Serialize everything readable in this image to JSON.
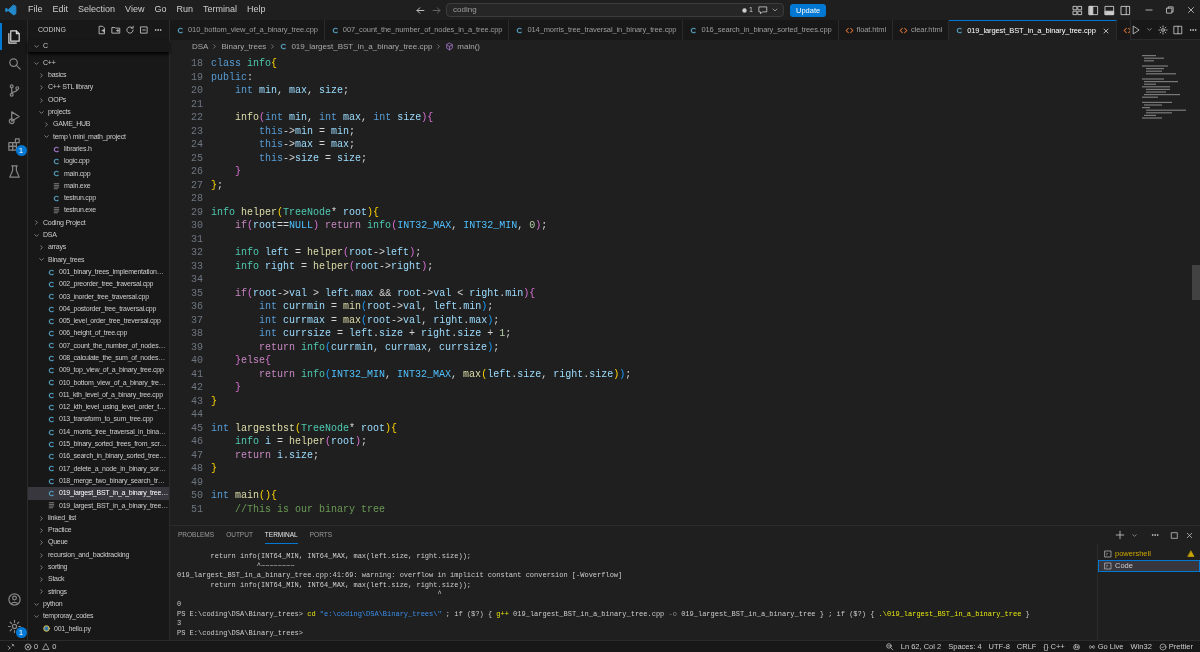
{
  "title_bar": {
    "menu": [
      "File",
      "Edit",
      "Selection",
      "View",
      "Go",
      "Run",
      "Terminal",
      "Help"
    ],
    "command_center": "coding",
    "notification_count": "1",
    "update_button": "Update"
  },
  "activity_bar": [
    {
      "kind": "explorer",
      "selected": true
    },
    {
      "kind": "search",
      "selected": false
    },
    {
      "kind": "source_control",
      "selected": false
    },
    {
      "kind": "run_debug",
      "selected": false
    },
    {
      "kind": "extensions",
      "selected": false,
      "badge": "1"
    },
    {
      "kind": "testing",
      "selected": false
    },
    {
      "kind": "account",
      "selected": false
    },
    {
      "kind": "manage",
      "selected": false,
      "badge": "1"
    }
  ],
  "sidebar": {
    "title": "CODING",
    "tree": [
      {
        "label": "C",
        "kind": "folder",
        "expanded": true,
        "selected": false
      },
      {
        "label": "C++",
        "kind": "folder",
        "expanded": true,
        "selected": false,
        "children": [
          {
            "label": "basics",
            "kind": "folder",
            "expanded": false,
            "selected": false
          },
          {
            "label": "C++ STL library",
            "kind": "folder",
            "expanded": false,
            "selected": false
          },
          {
            "label": "OOPs",
            "kind": "folder",
            "expanded": false,
            "selected": false
          },
          {
            "label": "projects",
            "kind": "folder",
            "expanded": true,
            "selected": false,
            "children": [
              {
                "label": "GAME_HUB",
                "kind": "folder",
                "expanded": false,
                "selected": false
              },
              {
                "label": "temp \\ mini_math_project",
                "kind": "folder",
                "expanded": true,
                "selected": false,
                "children": [
                  {
                    "label": "libraries.h",
                    "kind": "h",
                    "selected": false
                  },
                  {
                    "label": "logic.cpp",
                    "kind": "cpp",
                    "selected": false
                  },
                  {
                    "label": "main.cpp",
                    "kind": "cpp",
                    "selected": false
                  },
                  {
                    "label": "main.exe",
                    "kind": "exe",
                    "selected": false
                  },
                  {
                    "label": "testrun.cpp",
                    "kind": "cpp",
                    "selected": false
                  },
                  {
                    "label": "testrun.exe",
                    "kind": "exe",
                    "selected": false
                  }
                ]
              }
            ]
          }
        ]
      },
      {
        "label": "Coding Project",
        "kind": "folder",
        "expanded": false,
        "selected": false
      },
      {
        "label": "DSA",
        "kind": "folder",
        "expanded": true,
        "selected": false,
        "children": [
          {
            "label": "arrays",
            "kind": "folder",
            "expanded": false,
            "selected": false
          },
          {
            "label": "Binary_trees",
            "kind": "folder",
            "expanded": true,
            "selected": false,
            "children": [
              {
                "label": "001_binary_trees_implementation…",
                "kind": "cpp",
                "selected": false
              },
              {
                "label": "002_preorder_tree_traversal.cpp",
                "kind": "cpp",
                "selected": false
              },
              {
                "label": "003_inorder_tree_traversal.cpp",
                "kind": "cpp",
                "selected": false
              },
              {
                "label": "004_postorder_tree_traversal.cpp",
                "kind": "cpp",
                "selected": false
              },
              {
                "label": "005_level_order_tree_treversal.cpp",
                "kind": "cpp",
                "selected": false
              },
              {
                "label": "006_height_of_tree.cpp",
                "kind": "cpp",
                "selected": false
              },
              {
                "label": "007_count_the_number_of_nodes…",
                "kind": "cpp",
                "selected": false
              },
              {
                "label": "008_calculate_the_sum_of_nodes…",
                "kind": "cpp",
                "selected": false
              },
              {
                "label": "009_top_view_of_a_binary_tree.cpp",
                "kind": "cpp",
                "selected": false
              },
              {
                "label": "010_bottom_view_of_a_binary_tre…",
                "kind": "cpp",
                "selected": false
              },
              {
                "label": "011_kth_level_of_a_binary_tree.cpp",
                "kind": "cpp",
                "selected": false
              },
              {
                "label": "012_kth_level_using_level_order_t…",
                "kind": "cpp",
                "selected": false
              },
              {
                "label": "013_transform_to_sum_tree.cpp",
                "kind": "cpp",
                "selected": false
              },
              {
                "label": "014_morris_tree_traversal_in_bina…",
                "kind": "cpp",
                "selected": false
              },
              {
                "label": "015_binary_sorted_trees_from_scr…",
                "kind": "cpp",
                "selected": false
              },
              {
                "label": "016_search_in_binary_sorted_tree…",
                "kind": "cpp",
                "selected": false
              },
              {
                "label": "017_delete_a_node_in_binary_sor…",
                "kind": "cpp",
                "selected": false
              },
              {
                "label": "018_merge_two_binary_search_tr…",
                "kind": "cpp",
                "selected": false
              },
              {
                "label": "019_largest_BST_in_a_binary_tree…",
                "kind": "cpp",
                "selected": true
              },
              {
                "label": "019_largest_BST_in_a_binary_tree…",
                "kind": "exe",
                "selected": false
              }
            ]
          },
          {
            "label": "linked_list",
            "kind": "folder",
            "expanded": false,
            "selected": false
          },
          {
            "label": "Practice",
            "kind": "folder",
            "expanded": false,
            "selected": false
          },
          {
            "label": "Queue",
            "kind": "folder",
            "expanded": false,
            "selected": false
          },
          {
            "label": "recursion_and_backtracking",
            "kind": "folder",
            "expanded": false,
            "selected": false
          },
          {
            "label": "sorting",
            "kind": "folder",
            "expanded": false,
            "selected": false
          },
          {
            "label": "Stack",
            "kind": "folder",
            "expanded": false,
            "selected": false
          },
          {
            "label": "strings",
            "kind": "folder",
            "expanded": false,
            "selected": false
          }
        ]
      },
      {
        "label": "python",
        "kind": "folder",
        "expanded": true,
        "selected": false
      },
      {
        "label": "temproray_codes",
        "kind": "folder",
        "expanded": true,
        "selected": false,
        "children": [
          {
            "label": "001_hello.py",
            "kind": "py",
            "selected": false
          }
        ]
      }
    ]
  },
  "editor_tabs": [
    {
      "label": "010_bottom_view_of_a_binary_tree.cpp",
      "kind": "cpp",
      "selected": false
    },
    {
      "label": "007_count_the_number_of_nodes_in_a_tree.cpp",
      "kind": "cpp",
      "selected": false
    },
    {
      "label": "014_morris_tree_traversal_in_binary_tree.cpp",
      "kind": "cpp",
      "selected": false
    },
    {
      "label": "016_search_in_binary_sorted_trees.cpp",
      "kind": "cpp",
      "selected": false
    },
    {
      "label": "float.html",
      "kind": "html",
      "selected": false
    },
    {
      "label": "clear.html",
      "kind": "html",
      "selected": false
    },
    {
      "label": "019_largest_BST_in_a_binary_tree.cpp",
      "kind": "cpp",
      "selected": true
    },
    {
      "kind": "html",
      "selected": false
    }
  ],
  "breadcrumb": [
    {
      "label": "DSA",
      "kind": "folder"
    },
    {
      "label": "Binary_trees",
      "kind": "folder"
    },
    {
      "label": "019_largest_BST_in_a_binary_tree.cpp",
      "kind": "cpp"
    },
    {
      "label": "main()",
      "kind": "function"
    }
  ],
  "code": [
    {
      "no": "18",
      "tokens": [
        {
          "kind": "keyword",
          "text": "class "
        },
        {
          "kind": "type",
          "text": "info"
        },
        {
          "kind": "bracket1",
          "text": "{"
        }
      ]
    },
    {
      "no": "19",
      "tokens": [
        {
          "kind": "keyword",
          "text": "public"
        },
        {
          "kind": "punct",
          "text": ":"
        }
      ]
    },
    {
      "no": "20",
      "tokens": [
        {
          "kind": "keyword",
          "text": "    int "
        },
        {
          "kind": "variable",
          "text": "min"
        },
        {
          "kind": "punct",
          "text": ", "
        },
        {
          "kind": "variable",
          "text": "max"
        },
        {
          "kind": "punct",
          "text": ", "
        },
        {
          "kind": "variable",
          "text": "size"
        },
        {
          "kind": "punct",
          "text": ";"
        }
      ]
    },
    {
      "no": "21"
    },
    {
      "no": "22",
      "tokens": [
        {
          "kind": "function",
          "text": "    info"
        },
        {
          "kind": "bracket2",
          "text": "("
        },
        {
          "kind": "keyword",
          "text": "int "
        },
        {
          "kind": "variable",
          "text": "min"
        },
        {
          "kind": "punct",
          "text": ", "
        },
        {
          "kind": "keyword",
          "text": "int "
        },
        {
          "kind": "variable",
          "text": "max"
        },
        {
          "kind": "punct",
          "text": ", "
        },
        {
          "kind": "keyword",
          "text": "int "
        },
        {
          "kind": "variable",
          "text": "size"
        },
        {
          "kind": "bracket2",
          "text": "){"
        }
      ]
    },
    {
      "no": "23",
      "tokens": [
        {
          "kind": "keyword",
          "text": "        this"
        },
        {
          "kind": "punct",
          "text": "->"
        },
        {
          "kind": "variable",
          "text": "min"
        },
        {
          "kind": "punct",
          "text": " = "
        },
        {
          "kind": "variable",
          "text": "min"
        },
        {
          "kind": "punct",
          "text": ";"
        }
      ]
    },
    {
      "no": "24",
      "tokens": [
        {
          "kind": "keyword",
          "text": "        this"
        },
        {
          "kind": "punct",
          "text": "->"
        },
        {
          "kind": "variable",
          "text": "max"
        },
        {
          "kind": "punct",
          "text": " = "
        },
        {
          "kind": "variable",
          "text": "max"
        },
        {
          "kind": "punct",
          "text": ";"
        }
      ]
    },
    {
      "no": "25",
      "tokens": [
        {
          "kind": "keyword",
          "text": "        this"
        },
        {
          "kind": "punct",
          "text": "->"
        },
        {
          "kind": "variable",
          "text": "size"
        },
        {
          "kind": "punct",
          "text": " = "
        },
        {
          "kind": "variable",
          "text": "size"
        },
        {
          "kind": "punct",
          "text": ";"
        }
      ]
    },
    {
      "no": "26",
      "tokens": [
        {
          "kind": "bracket2",
          "text": "    }"
        }
      ]
    },
    {
      "no": "27",
      "tokens": [
        {
          "kind": "bracket1",
          "text": "}"
        },
        {
          "kind": "punct",
          "text": ";"
        }
      ]
    },
    {
      "no": "28"
    },
    {
      "no": "29",
      "tokens": [
        {
          "kind": "type",
          "text": "info "
        },
        {
          "kind": "function",
          "text": "helper"
        },
        {
          "kind": "bracket1",
          "text": "("
        },
        {
          "kind": "type",
          "text": "TreeNode"
        },
        {
          "kind": "punct",
          "text": "* "
        },
        {
          "kind": "variable",
          "text": "root"
        },
        {
          "kind": "bracket1",
          "text": "){"
        }
      ]
    },
    {
      "no": "30",
      "tokens": [
        {
          "kind": "control",
          "text": "    if"
        },
        {
          "kind": "bracket2",
          "text": "("
        },
        {
          "kind": "variable",
          "text": "root"
        },
        {
          "kind": "punct",
          "text": "=="
        },
        {
          "kind": "macro",
          "text": "NULL"
        },
        {
          "kind": "bracket2",
          "text": ")"
        },
        {
          "kind": "control",
          "text": " return "
        },
        {
          "kind": "type",
          "text": "info"
        },
        {
          "kind": "bracket2",
          "text": "("
        },
        {
          "kind": "macro",
          "text": "INT32_MAX"
        },
        {
          "kind": "punct",
          "text": ", "
        },
        {
          "kind": "macro",
          "text": "INT32_MIN"
        },
        {
          "kind": "punct",
          "text": ", "
        },
        {
          "kind": "number",
          "text": "0"
        },
        {
          "kind": "bracket2",
          "text": ")"
        },
        {
          "kind": "punct",
          "text": ";"
        }
      ]
    },
    {
      "no": "31"
    },
    {
      "no": "32",
      "tokens": [
        {
          "kind": "type",
          "text": "    info "
        },
        {
          "kind": "variable",
          "text": "left"
        },
        {
          "kind": "punct",
          "text": " = "
        },
        {
          "kind": "function",
          "text": "helper"
        },
        {
          "kind": "bracket2",
          "text": "("
        },
        {
          "kind": "variable",
          "text": "root"
        },
        {
          "kind": "punct",
          "text": "->"
        },
        {
          "kind": "variable",
          "text": "left"
        },
        {
          "kind": "bracket2",
          "text": ")"
        },
        {
          "kind": "punct",
          "text": ";"
        }
      ]
    },
    {
      "no": "33",
      "tokens": [
        {
          "kind": "type",
          "text": "    info "
        },
        {
          "kind": "variable",
          "text": "right"
        },
        {
          "kind": "punct",
          "text": " = "
        },
        {
          "kind": "function",
          "text": "helper"
        },
        {
          "kind": "bracket2",
          "text": "("
        },
        {
          "kind": "variable",
          "text": "root"
        },
        {
          "kind": "punct",
          "text": "->"
        },
        {
          "kind": "variable",
          "text": "right"
        },
        {
          "kind": "bracket2",
          "text": ")"
        },
        {
          "kind": "punct",
          "text": ";"
        }
      ]
    },
    {
      "no": "34"
    },
    {
      "no": "35",
      "tokens": [
        {
          "kind": "control",
          "text": "    if"
        },
        {
          "kind": "bracket2",
          "text": "("
        },
        {
          "kind": "variable",
          "text": "root"
        },
        {
          "kind": "punct",
          "text": "->"
        },
        {
          "kind": "variable",
          "text": "val"
        },
        {
          "kind": "punct",
          "text": " > "
        },
        {
          "kind": "variable",
          "text": "left"
        },
        {
          "kind": "punct",
          "text": "."
        },
        {
          "kind": "variable",
          "text": "max"
        },
        {
          "kind": "punct",
          "text": " && "
        },
        {
          "kind": "variable",
          "text": "root"
        },
        {
          "kind": "punct",
          "text": "->"
        },
        {
          "kind": "variable",
          "text": "val"
        },
        {
          "kind": "punct",
          "text": " < "
        },
        {
          "kind": "variable",
          "text": "right"
        },
        {
          "kind": "punct",
          "text": "."
        },
        {
          "kind": "variable",
          "text": "min"
        },
        {
          "kind": "bracket2",
          "text": "){"
        }
      ]
    },
    {
      "no": "36",
      "tokens": [
        {
          "kind": "keyword",
          "text": "        int "
        },
        {
          "kind": "variable",
          "text": "currmin"
        },
        {
          "kind": "punct",
          "text": " = "
        },
        {
          "kind": "function",
          "text": "min"
        },
        {
          "kind": "bracket3",
          "text": "("
        },
        {
          "kind": "variable",
          "text": "root"
        },
        {
          "kind": "punct",
          "text": "->"
        },
        {
          "kind": "variable",
          "text": "val"
        },
        {
          "kind": "punct",
          "text": ", "
        },
        {
          "kind": "variable",
          "text": "left"
        },
        {
          "kind": "punct",
          "text": "."
        },
        {
          "kind": "variable",
          "text": "min"
        },
        {
          "kind": "bracket3",
          "text": ")"
        },
        {
          "kind": "punct",
          "text": ";"
        }
      ]
    },
    {
      "no": "37",
      "tokens": [
        {
          "kind": "keyword",
          "text": "        int "
        },
        {
          "kind": "variable",
          "text": "currmax"
        },
        {
          "kind": "punct",
          "text": " = "
        },
        {
          "kind": "function",
          "text": "max"
        },
        {
          "kind": "bracket3",
          "text": "("
        },
        {
          "kind": "variable",
          "text": "root"
        },
        {
          "kind": "punct",
          "text": "->"
        },
        {
          "kind": "variable",
          "text": "val"
        },
        {
          "kind": "punct",
          "text": ", "
        },
        {
          "kind": "variable",
          "text": "right"
        },
        {
          "kind": "punct",
          "text": "."
        },
        {
          "kind": "variable",
          "text": "max"
        },
        {
          "kind": "bracket3",
          "text": ")"
        },
        {
          "kind": "punct",
          "text": ";"
        }
      ]
    },
    {
      "no": "38",
      "tokens": [
        {
          "kind": "keyword",
          "text": "        int "
        },
        {
          "kind": "variable",
          "text": "currsize"
        },
        {
          "kind": "punct",
          "text": " = "
        },
        {
          "kind": "variable",
          "text": "left"
        },
        {
          "kind": "punct",
          "text": "."
        },
        {
          "kind": "variable",
          "text": "size"
        },
        {
          "kind": "punct",
          "text": " + "
        },
        {
          "kind": "variable",
          "text": "right"
        },
        {
          "kind": "punct",
          "text": "."
        },
        {
          "kind": "variable",
          "text": "size"
        },
        {
          "kind": "punct",
          "text": " + "
        },
        {
          "kind": "number",
          "text": "1"
        },
        {
          "kind": "punct",
          "text": ";"
        }
      ]
    },
    {
      "no": "39",
      "tokens": [
        {
          "kind": "control",
          "text": "        return "
        },
        {
          "kind": "type",
          "text": "info"
        },
        {
          "kind": "bracket3",
          "text": "("
        },
        {
          "kind": "variable",
          "text": "currmin"
        },
        {
          "kind": "punct",
          "text": ", "
        },
        {
          "kind": "variable",
          "text": "currmax"
        },
        {
          "kind": "punct",
          "text": ", "
        },
        {
          "kind": "variable",
          "text": "currsize"
        },
        {
          "kind": "bracket3",
          "text": ")"
        },
        {
          "kind": "punct",
          "text": ";"
        }
      ]
    },
    {
      "no": "40",
      "tokens": [
        {
          "kind": "bracket2",
          "text": "    }"
        },
        {
          "kind": "control",
          "text": "else"
        },
        {
          "kind": "bracket2",
          "text": "{"
        }
      ]
    },
    {
      "no": "41",
      "tokens": [
        {
          "kind": "control",
          "text": "        return "
        },
        {
          "kind": "type",
          "text": "info"
        },
        {
          "kind": "bracket3",
          "text": "("
        },
        {
          "kind": "macro",
          "text": "INT32_MIN"
        },
        {
          "kind": "punct",
          "text": ", "
        },
        {
          "kind": "macro",
          "text": "INT32_MAX"
        },
        {
          "kind": "punct",
          "text": ", "
        },
        {
          "kind": "function",
          "text": "max"
        },
        {
          "kind": "bracket1",
          "text": "("
        },
        {
          "kind": "variable",
          "text": "left"
        },
        {
          "kind": "punct",
          "text": "."
        },
        {
          "kind": "variable",
          "text": "size"
        },
        {
          "kind": "punct",
          "text": ", "
        },
        {
          "kind": "variable",
          "text": "right"
        },
        {
          "kind": "punct",
          "text": "."
        },
        {
          "kind": "variable",
          "text": "size"
        },
        {
          "kind": "bracket1",
          "text": ")"
        },
        {
          "kind": "bracket3",
          "text": ")"
        },
        {
          "kind": "punct",
          "text": ";"
        }
      ]
    },
    {
      "no": "42",
      "tokens": [
        {
          "kind": "bracket2",
          "text": "    }"
        }
      ]
    },
    {
      "no": "43",
      "tokens": [
        {
          "kind": "bracket1",
          "text": "}"
        }
      ]
    },
    {
      "no": "44"
    },
    {
      "no": "45",
      "tokens": [
        {
          "kind": "keyword",
          "text": "int "
        },
        {
          "kind": "function",
          "text": "largestbst"
        },
        {
          "kind": "bracket1",
          "text": "("
        },
        {
          "kind": "type",
          "text": "TreeNode"
        },
        {
          "kind": "punct",
          "text": "* "
        },
        {
          "kind": "variable",
          "text": "root"
        },
        {
          "kind": "bracket1",
          "text": "){"
        }
      ]
    },
    {
      "no": "46",
      "tokens": [
        {
          "kind": "type",
          "text": "    info "
        },
        {
          "kind": "variable",
          "text": "i"
        },
        {
          "kind": "punct",
          "text": " = "
        },
        {
          "kind": "function",
          "text": "helper"
        },
        {
          "kind": "bracket2",
          "text": "("
        },
        {
          "kind": "variable",
          "text": "root"
        },
        {
          "kind": "bracket2",
          "text": ")"
        },
        {
          "kind": "punct",
          "text": ";"
        }
      ]
    },
    {
      "no": "47",
      "tokens": [
        {
          "kind": "control",
          "text": "    return "
        },
        {
          "kind": "variable",
          "text": "i"
        },
        {
          "kind": "punct",
          "text": "."
        },
        {
          "kind": "variable",
          "text": "size"
        },
        {
          "kind": "punct",
          "text": ";"
        }
      ]
    },
    {
      "no": "48",
      "tokens": [
        {
          "kind": "bracket1",
          "text": "}"
        }
      ]
    },
    {
      "no": "49"
    },
    {
      "no": "50",
      "tokens": [
        {
          "kind": "keyword",
          "text": "int "
        },
        {
          "kind": "function",
          "text": "main"
        },
        {
          "kind": "bracket1",
          "text": "(){"
        }
      ]
    },
    {
      "no": "51",
      "tokens": [
        {
          "kind": "comment",
          "text": "    //This is our binary tree"
        }
      ]
    }
  ],
  "panel": {
    "tabs": [
      {
        "label": "PROBLEMS",
        "selected": false
      },
      {
        "label": "OUTPUT",
        "selected": false
      },
      {
        "label": "TERMINAL",
        "selected": true
      },
      {
        "label": "PORTS",
        "selected": false
      }
    ],
    "terminal": [
      [
        {
          "kind": "output",
          "text": "        return info(INT64_MIN, INT64_MAX, max(left.size, right.size));"
        }
      ],
      [
        {
          "kind": "output",
          "text": "                   ^~~~~~~~~"
        }
      ],
      [
        {
          "kind": "output",
          "text": "019_largest_BST_in_a_binary_tree.cpp:41:69: warning: overflow in implicit constant conversion [-Woverflow]"
        }
      ],
      [
        {
          "kind": "output",
          "text": "        return info(INT64_MIN, INT64_MAX, max(left.size, right.size));"
        }
      ],
      [
        {
          "kind": "output",
          "text": "                                                              ^"
        }
      ],
      [
        {
          "kind": "output",
          "text": "0"
        }
      ],
      [
        {
          "kind": "output",
          "text": "PS E:\\coding\\DSA\\Binary_trees> "
        },
        {
          "kind": "command",
          "text": "cd "
        },
        {
          "kind": "string",
          "text": "\"e:\\coding\\DSA\\Binary_trees\\\""
        },
        {
          "kind": "output",
          "text": " ; if ($?) { "
        },
        {
          "kind": "command",
          "text": "g++ "
        },
        {
          "kind": "output",
          "text": "019_largest_BST_in_a_binary_tree.cpp "
        },
        {
          "kind": "param",
          "text": "-o "
        },
        {
          "kind": "output",
          "text": "019_largest_BST_in_a_binary_tree } ; if ($?) { "
        },
        {
          "kind": "command",
          "text": ".\\019_largest_BST_in_a_binary_tree"
        },
        {
          "kind": "output",
          "text": " }"
        }
      ],
      [
        {
          "kind": "output",
          "text": "3"
        }
      ],
      [
        {
          "kind": "output",
          "text": "PS E:\\coding\\DSA\\Binary_trees>"
        }
      ]
    ],
    "terminals": [
      {
        "label": "powershell",
        "selected": false,
        "warning": true
      },
      {
        "label": "Code",
        "selected": true,
        "warning": false
      }
    ]
  },
  "status_bar": {
    "errors": "0",
    "warnings": "0",
    "right": [
      {
        "kind": "zoom"
      },
      {
        "kind": "text",
        "text": "Ln 62, Col 2"
      },
      {
        "kind": "text",
        "text": "Spaces: 4"
      },
      {
        "kind": "text",
        "text": "UTF-8"
      },
      {
        "kind": "text",
        "text": "CRLF"
      },
      {
        "kind": "text",
        "text": "{} C++"
      },
      {
        "kind": "copilot"
      },
      {
        "kind": "golive",
        "text": "Go Live"
      },
      {
        "kind": "text",
        "text": "Win32"
      },
      {
        "kind": "prettier",
        "text": "Prettier"
      }
    ]
  }
}
